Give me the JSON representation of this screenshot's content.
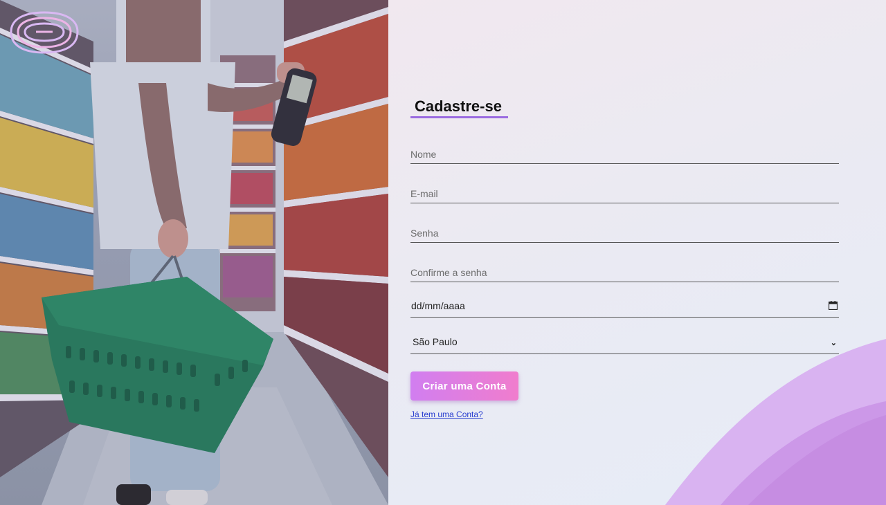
{
  "form": {
    "title": "Cadastre-se",
    "name_placeholder": "Nome",
    "email_placeholder": "E-mail",
    "password_placeholder": "Senha",
    "confirm_placeholder": "Confirme a senha",
    "date_placeholder": "dd/mm/aaaa",
    "state_selected": "São Paulo",
    "submit_label": "Criar uma Conta",
    "login_link": "Já tem uma Conta?"
  },
  "icons": {
    "logo": "spiral-logo-icon",
    "calendar": "calendar-icon",
    "select": "chevron-down-icon"
  },
  "colors": {
    "accent": "#9a6be0",
    "button_start": "#d17ef0",
    "button_end": "#f07dcd",
    "link": "#2a3fd0"
  }
}
